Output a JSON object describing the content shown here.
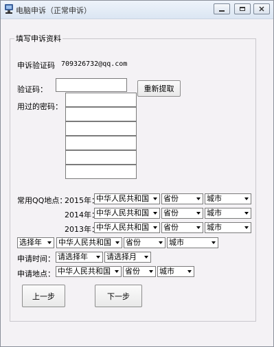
{
  "window": {
    "title": "电脑申诉（正常申诉）"
  },
  "group_title": "填写申诉资料",
  "verify_code_label": "申诉验证码",
  "verify_code_value": "709326732@qq.com",
  "captcha": {
    "label": "验证码：",
    "value": "",
    "refresh_button": "重新提取"
  },
  "passwords": {
    "label": "用过的密码：",
    "fields": [
      "",
      "",
      "",
      "",
      "",
      ""
    ]
  },
  "qq_locations": {
    "label": "常用QQ地点：",
    "years": [
      {
        "year": "2015年：",
        "country": "中华人民共和国",
        "province": "省份",
        "city": "城市"
      },
      {
        "year": "2014年：",
        "country": "中华人民共和国",
        "province": "省份",
        "city": "城市"
      },
      {
        "year": "2013年：",
        "country": "中华人民共和国",
        "province": "省份",
        "city": "城市"
      }
    ]
  },
  "extra_location": {
    "year": "选择年",
    "country": "中华人民共和国",
    "province": "省份",
    "city": "城市"
  },
  "apply_time": {
    "label": "申请时间：",
    "year": "请选择年",
    "month": "请选择月"
  },
  "apply_location": {
    "label": "申请地点：",
    "country": "中华人民共和国",
    "province": "省份",
    "city": "城市"
  },
  "buttons": {
    "prev": "上一步",
    "next": "下一步"
  }
}
